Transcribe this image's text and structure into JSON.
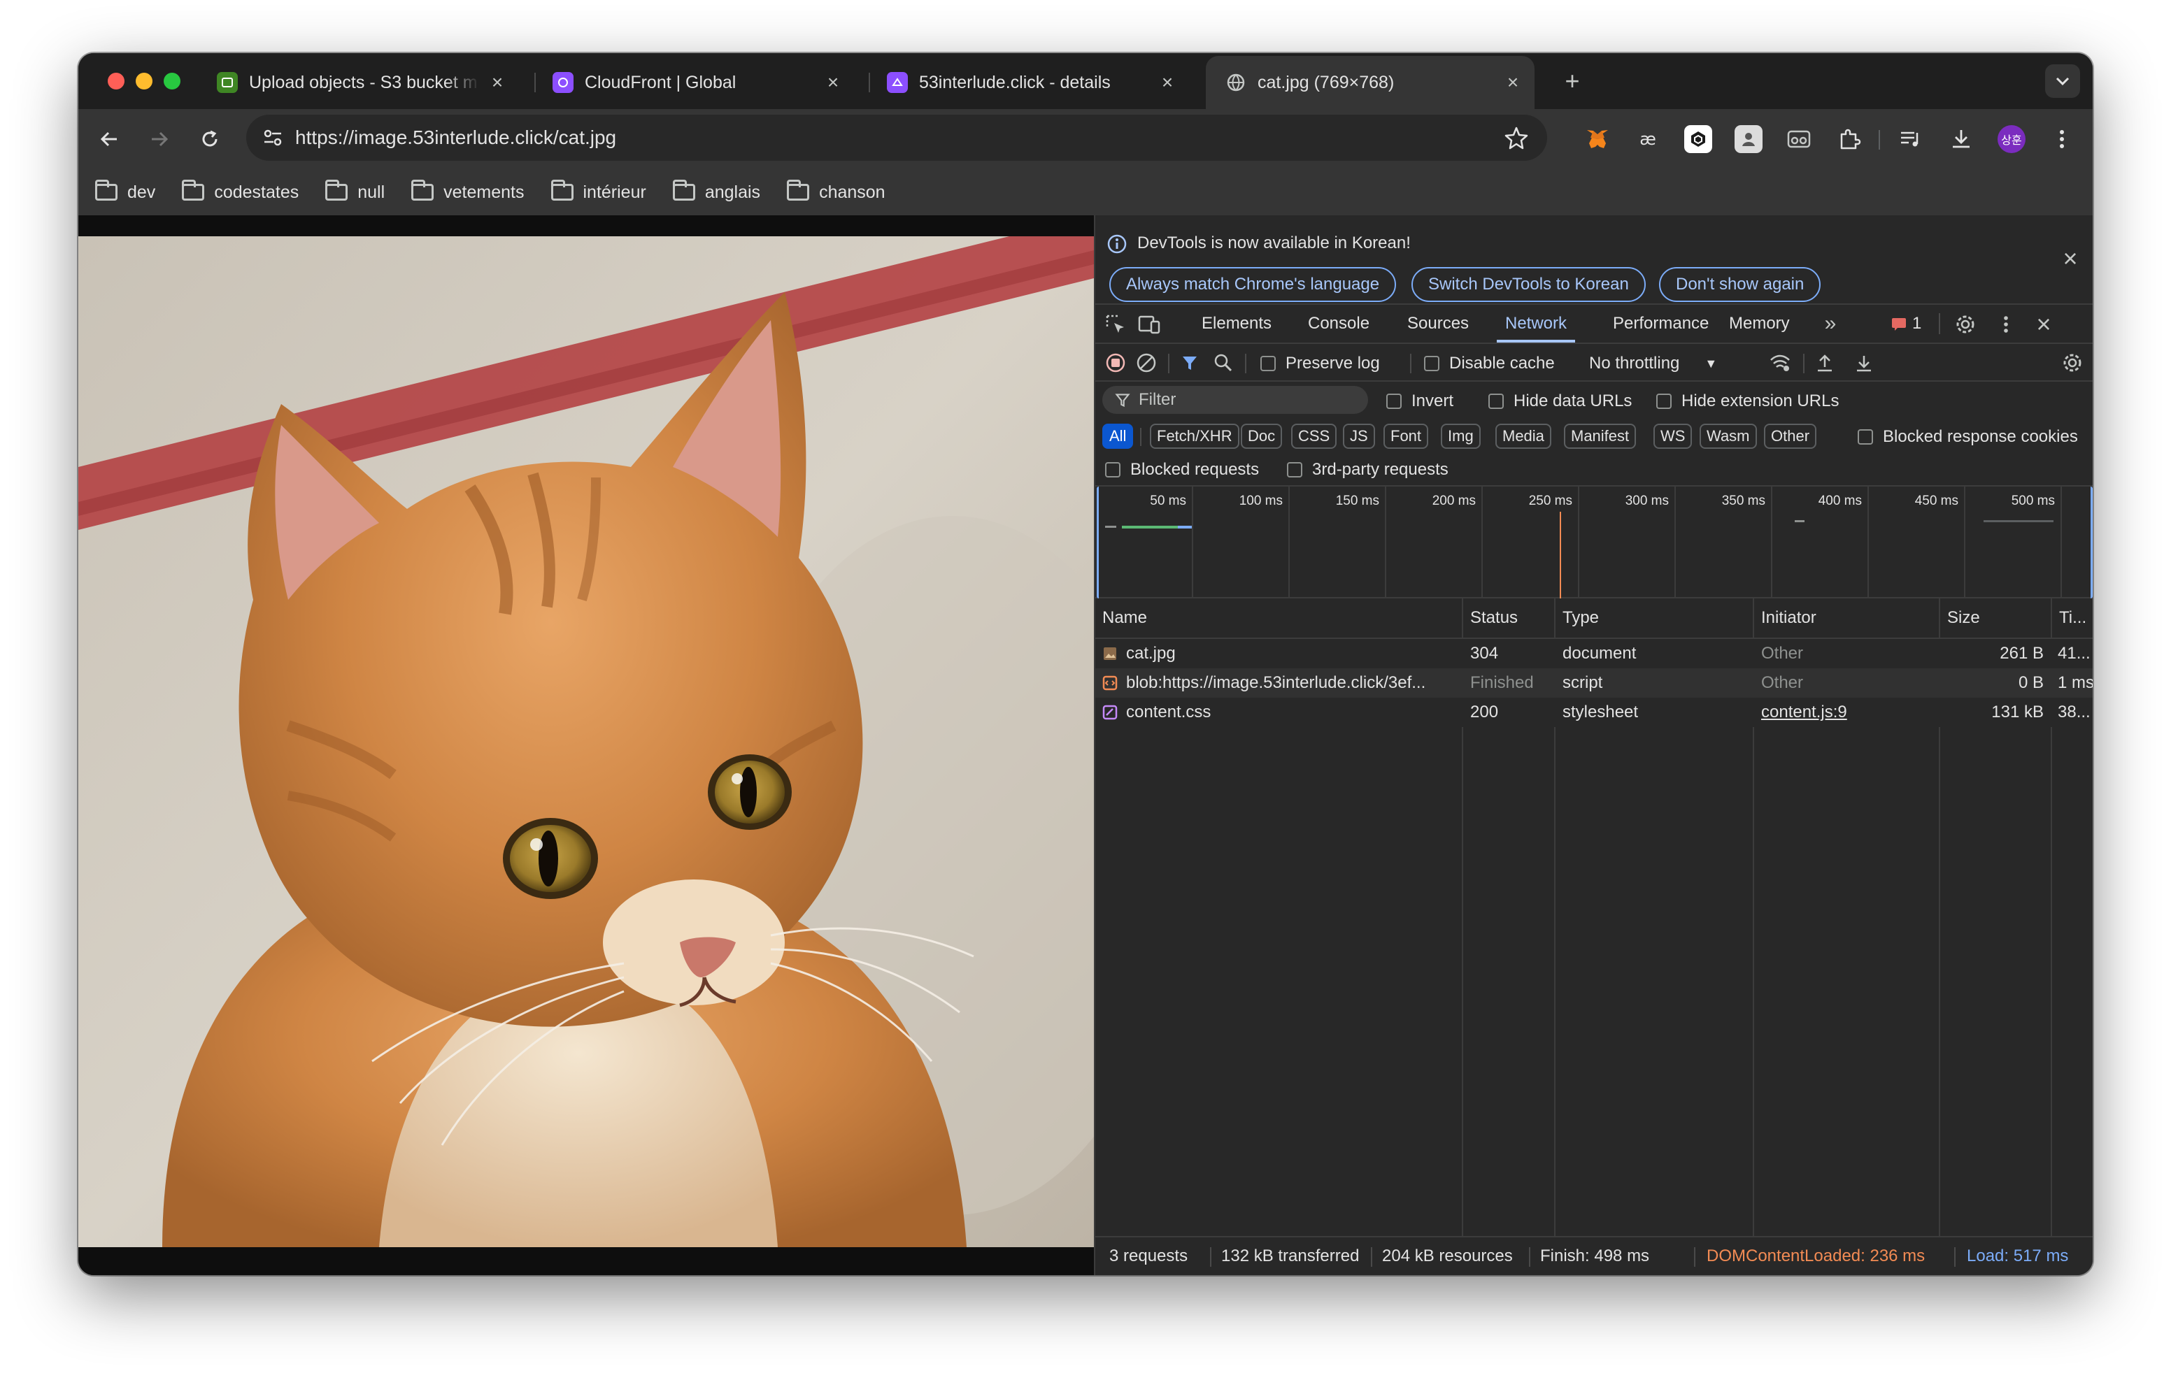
{
  "browser": {
    "tabs": [
      {
        "title": "Upload objects - S3 bucket m",
        "favicon": "s3-icon",
        "favicon_color": "#3f8624"
      },
      {
        "title": "CloudFront | Global",
        "favicon": "cloudfront-icon",
        "favicon_color": "#8c4fff"
      },
      {
        "title": "53interlude.click - details",
        "favicon": "route53-icon",
        "favicon_color": "#8c4fff"
      },
      {
        "title": "cat.jpg (769×768)",
        "favicon": "globe-icon",
        "active": true
      }
    ],
    "new_tab_label": "+",
    "url": "https://image.53interlude.click/cat.jpg",
    "profile_initials": "상훈",
    "bookmarks": [
      "dev",
      "codestates",
      "null",
      "vetements",
      "intérieur",
      "anglais",
      "chanson"
    ]
  },
  "devtools": {
    "infobar": {
      "message": "DevTools is now available in Korean!",
      "buttons": [
        "Always match Chrome's language",
        "Switch DevTools to Korean",
        "Don't show again"
      ]
    },
    "tabs": [
      "Elements",
      "Console",
      "Sources",
      "Network",
      "Performance",
      "Memory"
    ],
    "active_tab": "Network",
    "issues_count": "1",
    "network": {
      "preserve_log": "Preserve log",
      "disable_cache": "Disable cache",
      "throttling": "No throttling",
      "filter_placeholder": "Filter",
      "invert": "Invert",
      "hide_data_urls": "Hide data URLs",
      "hide_extension_urls": "Hide extension URLs",
      "type_filters": [
        "All",
        "Fetch/XHR",
        "Doc",
        "CSS",
        "JS",
        "Font",
        "Img",
        "Media",
        "Manifest",
        "WS",
        "Wasm",
        "Other"
      ],
      "active_type_filter": "All",
      "blocked_response_cookies": "Blocked response cookies",
      "blocked_requests": "Blocked requests",
      "third_party_requests": "3rd-party requests",
      "timeline_ticks": [
        "50 ms",
        "100 ms",
        "150 ms",
        "200 ms",
        "250 ms",
        "300 ms",
        "350 ms",
        "400 ms",
        "450 ms",
        "500 ms"
      ],
      "columns": [
        "Name",
        "Status",
        "Type",
        "Initiator",
        "Size",
        "Ti..."
      ],
      "rows": [
        {
          "name": "cat.jpg",
          "status": "304",
          "type": "document",
          "initiator": "Other",
          "size": "261 B",
          "time": "41...",
          "icon": "image-file-icon"
        },
        {
          "name": "blob:https://image.53interlude.click/3ef...",
          "status": "Finished",
          "type": "script",
          "initiator": "Other",
          "size": "0 B",
          "time": "1 ms",
          "icon": "script-file-icon"
        },
        {
          "name": "content.css",
          "status": "200",
          "type": "stylesheet",
          "initiator": "content.js:9",
          "size": "131 kB",
          "time": "38...",
          "icon": "css-file-icon"
        }
      ],
      "summary": {
        "requests": "3 requests",
        "transferred": "132 kB transferred",
        "resources": "204 kB resources",
        "finish": "Finish: 498 ms",
        "dom_content_loaded": "DOMContentLoaded: 236 ms",
        "load": "Load: 517 ms"
      }
    }
  },
  "colors": {
    "accent": "#a8c7fa",
    "dom_content_loaded": "#f28b54",
    "load": "#7cacf8",
    "record": "#f2b8b5"
  }
}
